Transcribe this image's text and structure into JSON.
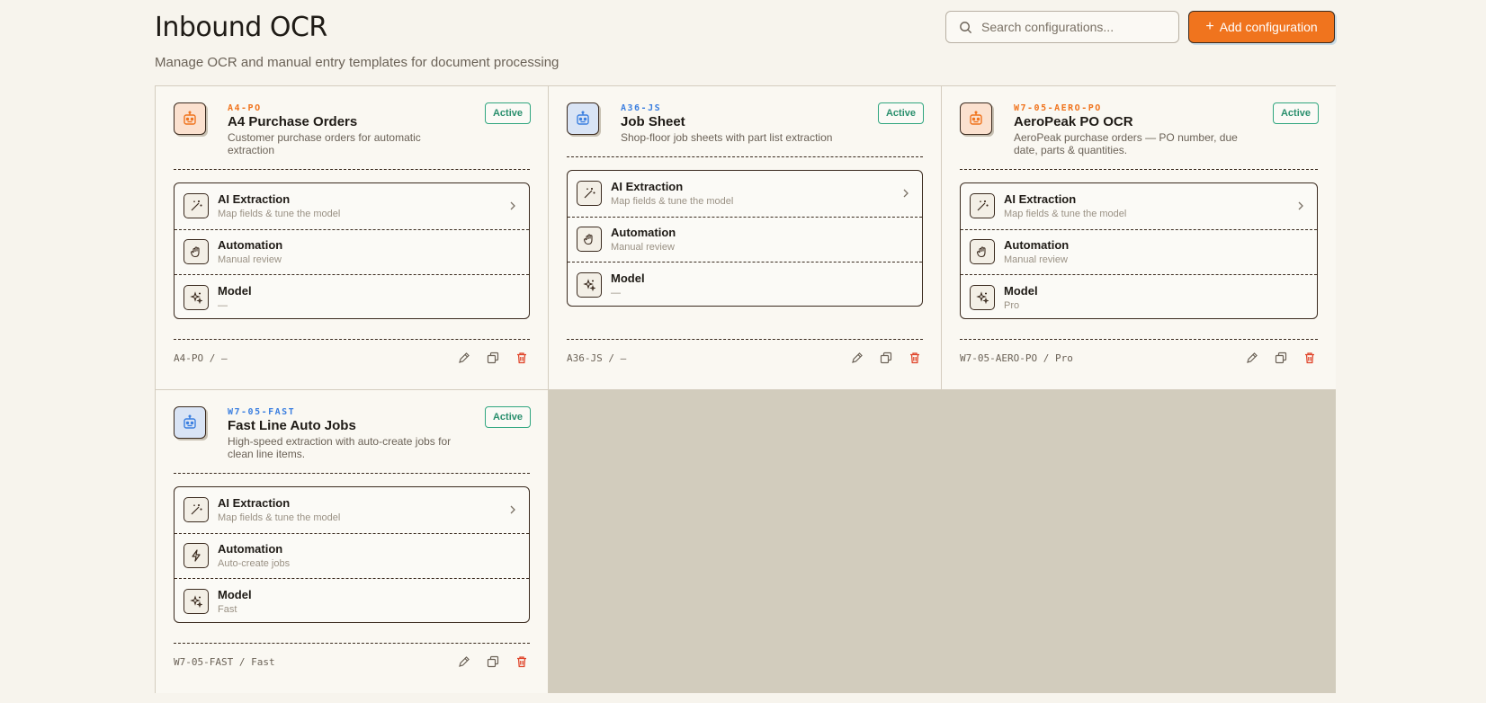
{
  "header": {
    "title": "Inbound OCR",
    "subtitle": "Manage OCR and manual entry templates for document processing"
  },
  "search": {
    "placeholder": "Search configurations..."
  },
  "add_button": {
    "label": "Add configuration",
    "icon": "plus-icon"
  },
  "colors": {
    "accent": "#f0741e",
    "active": "#2fa67f",
    "blue": "#3b7fe0",
    "empty_cell": "#d2ccbd"
  },
  "cards": [
    {
      "code": "A4-PO",
      "name": "A4 Purchase Orders",
      "desc": "Customer purchase orders for automatic extraction",
      "status": "Active",
      "icon": "robot-icon",
      "accent": "orange",
      "rows": [
        {
          "label": "AI Extraction",
          "sub": "Map fields & tune the model",
          "icon": "wand-icon"
        },
        {
          "label": "Automation",
          "sub": "Manual review",
          "icon": "hand-icon"
        },
        {
          "label": "Model",
          "sub": "—",
          "icon": "sparkle-icon"
        }
      ],
      "footer": "A4-PO / —"
    },
    {
      "code": "A36-JS",
      "name": "Job Sheet",
      "desc": "Shop-floor job sheets with part list extraction",
      "status": "Active",
      "icon": "robot-icon",
      "accent": "blue",
      "rows": [
        {
          "label": "AI Extraction",
          "sub": "Map fields & tune the model",
          "icon": "wand-icon"
        },
        {
          "label": "Automation",
          "sub": "Manual review",
          "icon": "hand-icon"
        },
        {
          "label": "Model",
          "sub": "—",
          "icon": "sparkle-icon"
        }
      ],
      "footer": "A36-JS / —"
    },
    {
      "code": "W7-05-AERO-PO",
      "name": "AeroPeak PO OCR",
      "desc": "AeroPeak purchase orders — PO number, due date, parts & quantities.",
      "status": "Active",
      "icon": "robot-icon",
      "accent": "orange",
      "rows": [
        {
          "label": "AI Extraction",
          "sub": "Map fields & tune the model",
          "icon": "wand-icon"
        },
        {
          "label": "Automation",
          "sub": "Manual review",
          "icon": "hand-icon"
        },
        {
          "label": "Model",
          "sub": "Pro",
          "icon": "sparkle-icon"
        }
      ],
      "footer": "W7-05-AERO-PO / Pro"
    },
    {
      "code": "W7-05-FAST",
      "name": "Fast Line Auto Jobs",
      "desc": "High-speed extraction with auto-create jobs for clean line items.",
      "status": "Active",
      "icon": "robot-icon",
      "accent": "blue",
      "rows": [
        {
          "label": "AI Extraction",
          "sub": "Map fields & tune the model",
          "icon": "wand-icon"
        },
        {
          "label": "Automation",
          "sub": "Auto-create jobs",
          "icon": "bolt-icon"
        },
        {
          "label": "Model",
          "sub": "Fast",
          "icon": "sparkle-icon"
        }
      ],
      "footer": "W7-05-FAST / Fast"
    }
  ]
}
